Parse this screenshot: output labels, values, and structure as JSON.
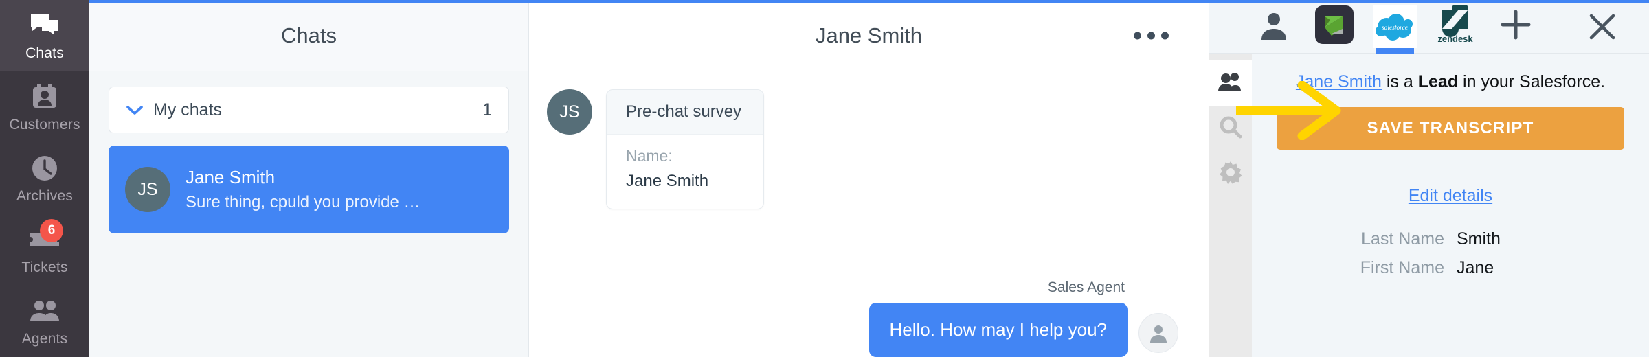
{
  "theme": {
    "accent_blue": "#4285f4",
    "nav_bg": "#3b373f",
    "panel_bg": "#f2f6f9",
    "save_orange": "#eca140",
    "badge_red": "#f4554a",
    "avatar_slate": "#566e78",
    "annotation_yellow": "#ffd400"
  },
  "nav": {
    "items": [
      {
        "label": "Chats",
        "icon": "chats-icon",
        "active": true,
        "badge": null
      },
      {
        "label": "Customers",
        "icon": "customers-icon",
        "active": false,
        "badge": null
      },
      {
        "label": "Archives",
        "icon": "archives-icon",
        "active": false,
        "badge": null
      },
      {
        "label": "Tickets",
        "icon": "tickets-icon",
        "active": false,
        "badge": "6"
      },
      {
        "label": "Agents",
        "icon": "agents-icon",
        "active": false,
        "badge": null
      }
    ]
  },
  "chat_list": {
    "header_title": "Chats",
    "group": {
      "label": "My chats",
      "count": "1",
      "expanded": true,
      "chevron": "chevron-down-icon"
    },
    "chats": [
      {
        "initials": "JS",
        "name": "Jane Smith",
        "preview": "Sure thing, cpuld you provide …",
        "selected": true
      }
    ]
  },
  "conversation": {
    "header_title": "Jane Smith",
    "more_menu_icon": "more-options-icon",
    "incoming": {
      "initials": "JS",
      "survey_title": "Pre-chat survey",
      "fields": [
        {
          "key": "Name:",
          "value": "Jane Smith"
        }
      ]
    },
    "outgoing": {
      "author": "Sales Agent",
      "text": "Hello. How may I help you?",
      "avatar_icon": "person-avatar-icon"
    }
  },
  "right_panel": {
    "apps": [
      {
        "name": "customer-details",
        "icon": "person-icon",
        "active": false
      },
      {
        "name": "livechat-app",
        "icon": "livechat-icon",
        "active": false
      },
      {
        "name": "salesforce",
        "icon": "salesforce-icon",
        "label": "salesforce",
        "active": true
      },
      {
        "name": "zendesk",
        "icon": "zendesk-icon",
        "label": "zendesk",
        "active": false
      },
      {
        "name": "add-app",
        "icon": "plus-icon",
        "active": false
      }
    ],
    "close_icon": "close-icon",
    "tool_rail": [
      {
        "name": "people-tool",
        "icon": "people-icon",
        "active": true
      },
      {
        "name": "search-tool",
        "icon": "search-icon",
        "active": false
      },
      {
        "name": "settings-tool",
        "icon": "gear-icon",
        "active": false
      }
    ],
    "lead_sentence": {
      "link_text": "Jane Smith",
      "mid_text": " is a ",
      "strong_text": "Lead",
      "tail_text": " in your Salesforce."
    },
    "save_button_label": "SAVE TRANSCRIPT",
    "edit_link_label": "Edit details",
    "details": [
      {
        "key": "Last Name",
        "value": "Smith"
      },
      {
        "key": "First Name",
        "value": "Jane"
      }
    ]
  },
  "annotation": {
    "arrow_icon": "arrow-right-annotation",
    "target": "SAVE TRANSCRIPT"
  }
}
